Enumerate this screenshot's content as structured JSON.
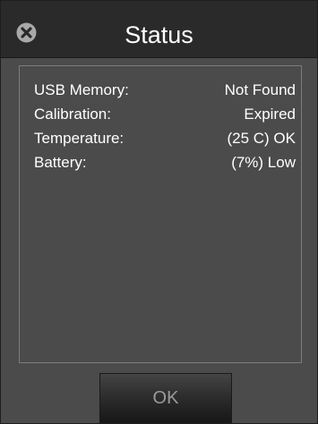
{
  "window": {
    "title": "Status",
    "close_icon": "close-circle-x-icon"
  },
  "status": {
    "rows": [
      {
        "label": "USB Memory:",
        "value": "Not Found"
      },
      {
        "label": "Calibration:",
        "value": "Expired"
      },
      {
        "label": "Temperature:",
        "value": "(25 C) OK"
      },
      {
        "label": "Battery:",
        "value": "(7%) Low"
      }
    ]
  },
  "actions": {
    "ok_label": "OK"
  },
  "colors": {
    "titlebar_bg": "#2a2a2a",
    "dialog_bg": "#4b4b4b",
    "panel_border": "#7c7c7c",
    "text": "#ffffff",
    "button_text": "#9a9a9a"
  }
}
